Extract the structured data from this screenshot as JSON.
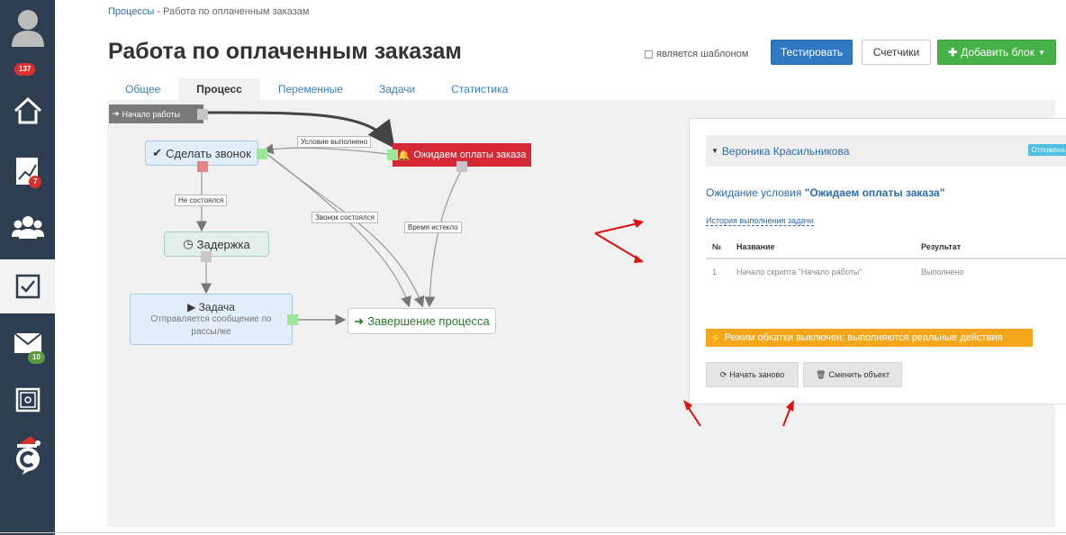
{
  "sidebar": {
    "items": [
      {
        "icon": "user-avatar-icon"
      },
      {
        "icon": "home-icon",
        "badge": "137"
      },
      {
        "icon": "chart-icon",
        "badge": "7"
      },
      {
        "icon": "users-icon"
      },
      {
        "icon": "checkbox-icon"
      },
      {
        "icon": "mail-icon",
        "badge": "10"
      },
      {
        "icon": "safe-icon"
      },
      {
        "icon": "brand-logo-icon"
      }
    ]
  },
  "breadcrumb": {
    "link": "Процессы",
    "separator": " - ",
    "current": "Работа по оплаченным заказам"
  },
  "page_title": "Работа по оплаченным заказам",
  "header": {
    "template_label": "является шаблоном",
    "test_label": "Тестировать",
    "counters_label": "Счетчики",
    "add_block_label": "Добавить блок"
  },
  "tabs": [
    {
      "label": "Общее"
    },
    {
      "label": "Процесс"
    },
    {
      "label": "Переменные"
    },
    {
      "label": "Задачи"
    },
    {
      "label": "Статистика"
    }
  ],
  "diagram": {
    "start": "Начало работы",
    "call": "Сделать звонок",
    "wait": "Ожидаем оплаты заказа",
    "delay": "Задержка",
    "task_title": "Задача",
    "task_sub": "Отправляется сообщение по рассылке",
    "end": "Завершение процесса",
    "edge_condition": "Условие выполнено",
    "edge_not_done": "Не состоялся",
    "edge_done": "Звонок состоялся",
    "edge_timeout": "Время истекло"
  },
  "panel": {
    "person": "Вероника Красильникова",
    "status": "Отложена",
    "cond_prefix": "Ожидание условия ",
    "cond_name": "\"Ожидаем оплаты заказа\"",
    "history_link": "История выполнения задачи",
    "columns": [
      "№",
      "Название",
      "Результат"
    ],
    "rows": [
      [
        "1",
        "Начало скрипта \"Начало работы\"",
        "Выполнено"
      ]
    ],
    "warning": "Режим обкатки выключен: выполняются реальные действия",
    "restart_label": "Начать заново",
    "change_label": "Сменить объект"
  },
  "colors": {
    "sidebar_bg": "#2d3e50",
    "primary": "#2f78c4",
    "success": "#45b147",
    "danger": "#d52a36",
    "warning": "#f5a71c"
  }
}
